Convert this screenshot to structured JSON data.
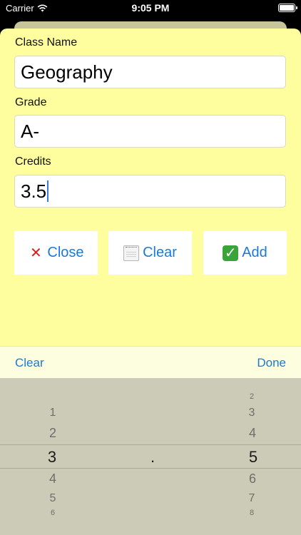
{
  "status_bar": {
    "carrier": "Carrier",
    "time": "9:05 PM"
  },
  "form": {
    "class_name": {
      "label": "Class Name",
      "value": "Geography"
    },
    "grade": {
      "label": "Grade",
      "value": "A-"
    },
    "credits": {
      "label": "Credits",
      "value": "3.5"
    }
  },
  "buttons": {
    "close": "Close",
    "clear": "Clear",
    "add": "Add"
  },
  "toolbar": {
    "clear": "Clear",
    "done": "Done"
  },
  "picker": {
    "left_column": [
      "1",
      "2",
      "3",
      "4",
      "5",
      "6"
    ],
    "left_selected": "3",
    "separator": ".",
    "right_column": [
      "2",
      "3",
      "4",
      "5",
      "6",
      "7",
      "8"
    ],
    "right_selected": "5"
  },
  "colors": {
    "sheet": "#fefe9e",
    "accent": "#1a7ad6",
    "picker_bg": "#cccbb8"
  }
}
